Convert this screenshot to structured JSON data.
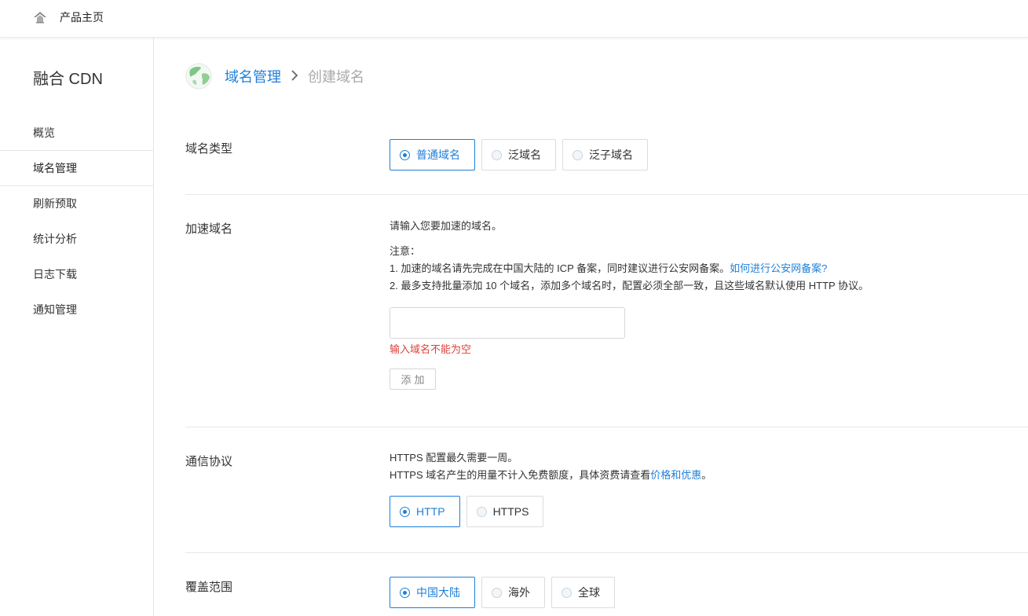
{
  "topbar": {
    "home_label": "产品主页"
  },
  "sidebar": {
    "title": "融合 CDN",
    "items": [
      {
        "label": "概览"
      },
      {
        "label": "域名管理"
      },
      {
        "label": "刷新预取"
      },
      {
        "label": "统计分析"
      },
      {
        "label": "日志下载"
      },
      {
        "label": "通知管理"
      }
    ]
  },
  "breadcrumb": {
    "parent": "域名管理",
    "separator": ">",
    "current": "创建域名"
  },
  "domain_type": {
    "label": "域名类型",
    "options": [
      "普通域名",
      "泛域名",
      "泛子域名"
    ],
    "selected": "普通域名"
  },
  "accel_domain": {
    "label": "加速域名",
    "intro": "请输入您要加速的域名。",
    "note_title": "注意：",
    "note1": "1. 加速的域名请先完成在中国大陆的 ICP 备案，同时建议进行公安网备案。",
    "note1_link": "如何进行公安网备案?",
    "note2": "2. 最多支持批量添加 10 个域名，添加多个域名时，配置必须全部一致，且这些域名默认使用 HTTP 协议。",
    "input_value": "",
    "error": "输入域名不能为空",
    "add_button": "添加"
  },
  "protocol": {
    "label": "通信协议",
    "line1": "HTTPS 配置最久需要一周。",
    "line2": "HTTPS 域名产生的用量不计入免费额度，具体资费请查看",
    "line2_link": "价格和优惠",
    "line2_end": "。",
    "options": [
      "HTTP",
      "HTTPS"
    ],
    "selected": "HTTP"
  },
  "coverage": {
    "label": "覆盖范围",
    "options": [
      "中国大陆",
      "海外",
      "全球"
    ],
    "selected": "中国大陆"
  },
  "colors": {
    "accent": "#1e7fd9",
    "error": "#e0403a"
  }
}
